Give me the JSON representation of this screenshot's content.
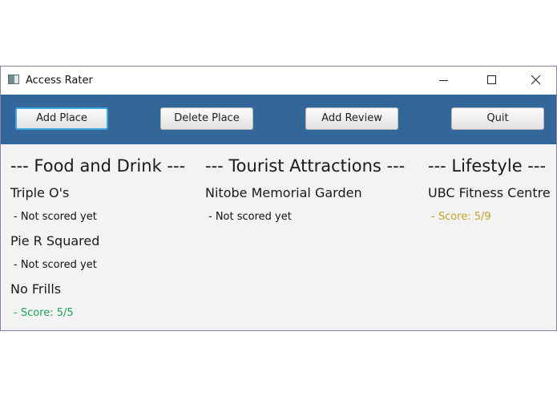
{
  "window": {
    "title": "Access Rater"
  },
  "toolbar": {
    "add_place": "Add Place",
    "delete_place": "Delete Place",
    "add_review": "Add Review",
    "quit": "Quit"
  },
  "colors": {
    "toolbar_bg": "#336699",
    "score_good": "#1fa35a",
    "score_medium": "#c3a12a"
  },
  "categories": [
    {
      "heading": "--- Food and Drink ---",
      "places": [
        {
          "name": "Triple O's",
          "score": "- Not scored yet"
        },
        {
          "name": "Pie R Squared",
          "score": "- Not scored yet"
        },
        {
          "name": "No Frills",
          "score": "- Score: 5/5"
        }
      ]
    },
    {
      "heading": "--- Tourist Attractions ---",
      "places": [
        {
          "name": "Nitobe Memorial Garden",
          "score": "- Not scored yet"
        }
      ]
    },
    {
      "heading": "--- Lifestyle ---",
      "places": [
        {
          "name": "UBC Fitness Centre",
          "score": "- Score: 5/9"
        }
      ]
    }
  ]
}
